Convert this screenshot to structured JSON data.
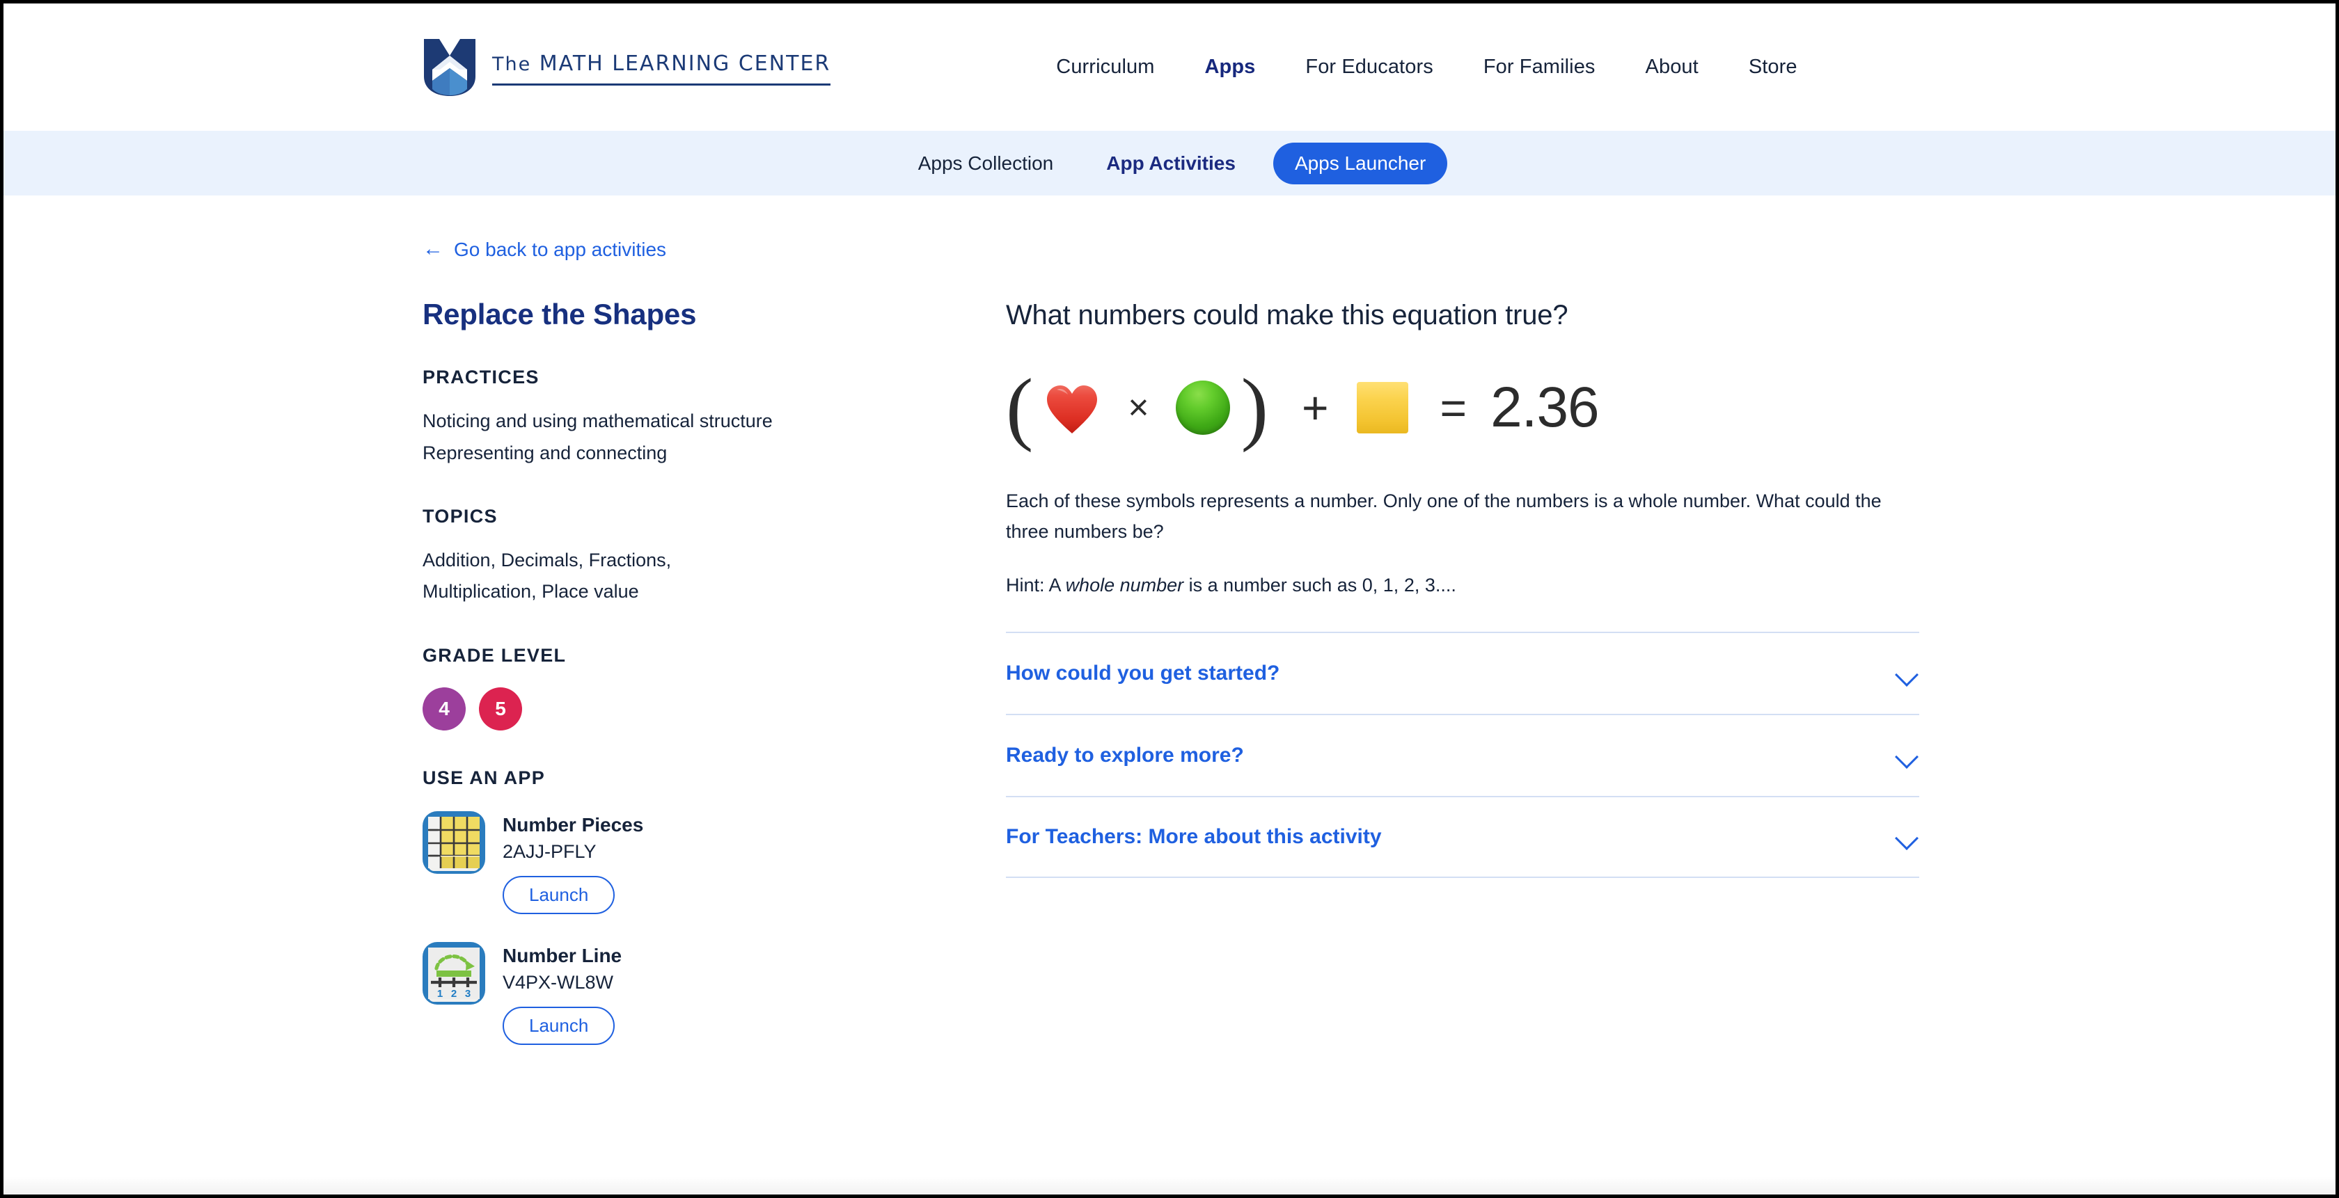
{
  "header": {
    "logo": {
      "the": "The",
      "name": "MATH LEARNING CENTER",
      "icon": "mlc-logo-icon"
    },
    "nav": [
      {
        "label": "Curriculum",
        "active": false
      },
      {
        "label": "Apps",
        "active": true
      },
      {
        "label": "For Educators",
        "active": false
      },
      {
        "label": "For Families",
        "active": false
      },
      {
        "label": "About",
        "active": false
      },
      {
        "label": "Store",
        "active": false
      }
    ]
  },
  "subnav": {
    "items": [
      {
        "label": "Apps Collection",
        "style": "plain"
      },
      {
        "label": "App Activities",
        "style": "strong"
      },
      {
        "label": "Apps Launcher",
        "style": "pill"
      }
    ],
    "background": "#eaf2fd",
    "pill_color": "#1f60e0"
  },
  "back_link": {
    "arrow": "←",
    "label": "Go back to app activities"
  },
  "sidebar": {
    "title": "Replace the Shapes",
    "sections": [
      {
        "heading": "PRACTICES",
        "body": "Noticing and using mathematical structure\nRepresenting and connecting"
      },
      {
        "heading": "TOPICS",
        "body": "Addition, Decimals, Fractions, Multiplication, Place value"
      }
    ],
    "grade_level": {
      "heading": "GRADE LEVEL",
      "badges": [
        {
          "label": "4",
          "color": "#9c3f9c"
        },
        {
          "label": "5",
          "color": "#dc2350"
        }
      ]
    },
    "use_an_app": {
      "heading": "USE AN APP",
      "apps": [
        {
          "name": "Number Pieces",
          "code": "2AJJ-PFLY",
          "launch_label": "Launch",
          "icon": "number-pieces-icon"
        },
        {
          "name": "Number Line",
          "code": "V4PX-WL8W",
          "launch_label": "Launch",
          "icon": "number-line-icon"
        }
      ]
    }
  },
  "main": {
    "heading": "What numbers could make this equation true?",
    "equation": {
      "open_paren": "(",
      "symbol_1": "heart-symbol",
      "operator_1": "×",
      "symbol_2": "green-circle-symbol",
      "close_paren": ")",
      "operator_2": "+",
      "symbol_3": "yellow-square-symbol",
      "equals": "=",
      "result": "2.36"
    },
    "prompt": "Each of these symbols represents a number. Only one of the numbers is a whole number. What could the three numbers be?",
    "hint_prefix": "Hint: A ",
    "hint_italic": "whole number",
    "hint_suffix": " is a number such as 0, 1, 2, 3....",
    "accordion": [
      {
        "label": "How could you get started?",
        "icon": "chevron-down-icon"
      },
      {
        "label": "Ready to explore more?",
        "icon": "chevron-down-icon"
      },
      {
        "label": "For Teachers: More about this activity",
        "icon": "chevron-down-icon"
      }
    ]
  }
}
